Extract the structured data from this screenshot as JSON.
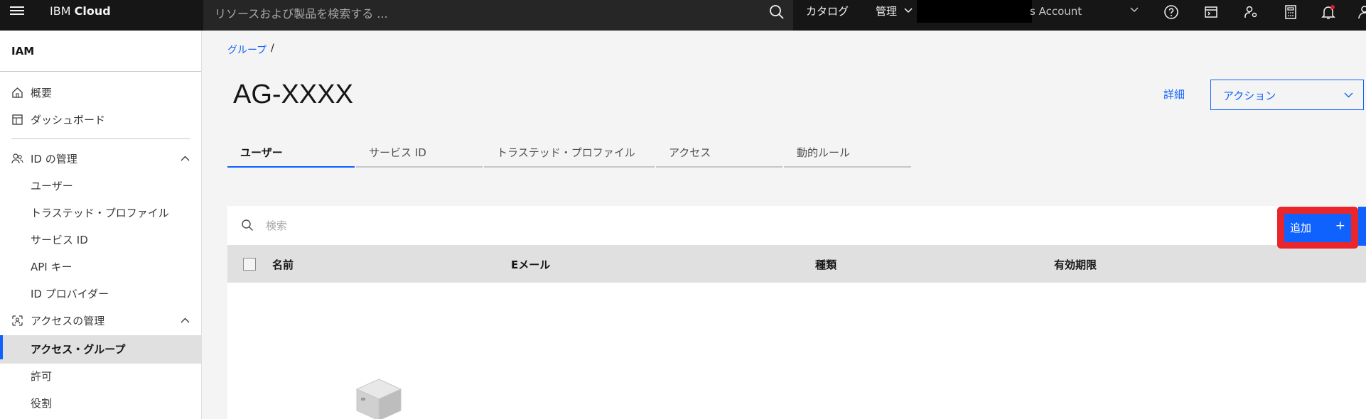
{
  "topbar": {
    "brand_prefix": "IBM",
    "brand_name": "Cloud",
    "search_placeholder": "リソースおよび製品を検索する ...",
    "catalog": "カタログ",
    "manage": "管理",
    "account": "s Account"
  },
  "sidebar": {
    "title": "IAM",
    "items": [
      {
        "label": "概要"
      },
      {
        "label": "ダッシュボード"
      },
      {
        "label": "ID の管理"
      },
      {
        "label": "ユーザー"
      },
      {
        "label": "トラステッド・プロファイル"
      },
      {
        "label": "サービス ID"
      },
      {
        "label": "API キー"
      },
      {
        "label": "ID プロバイダー"
      },
      {
        "label": "アクセスの管理"
      },
      {
        "label": "アクセス・グループ"
      },
      {
        "label": "許可"
      },
      {
        "label": "役割"
      }
    ]
  },
  "breadcrumb": {
    "link": "グループ",
    "separator": "/"
  },
  "page": {
    "title": "AG-XXXX",
    "details": "詳細",
    "actions": "アクション"
  },
  "tabs": [
    {
      "label": "ユーザー"
    },
    {
      "label": "サービス ID"
    },
    {
      "label": "トラステッド・プロファイル"
    },
    {
      "label": "アクセス"
    },
    {
      "label": "動的ルール"
    }
  ],
  "table": {
    "search_placeholder": "検索",
    "add_button": "追加",
    "add_icon": "+",
    "columns": [
      "名前",
      "Eメール",
      "種類",
      "有効期限"
    ]
  },
  "colors": {
    "accent": "#0f62fe",
    "highlight": "#e8262c",
    "topbar": "#161616"
  }
}
